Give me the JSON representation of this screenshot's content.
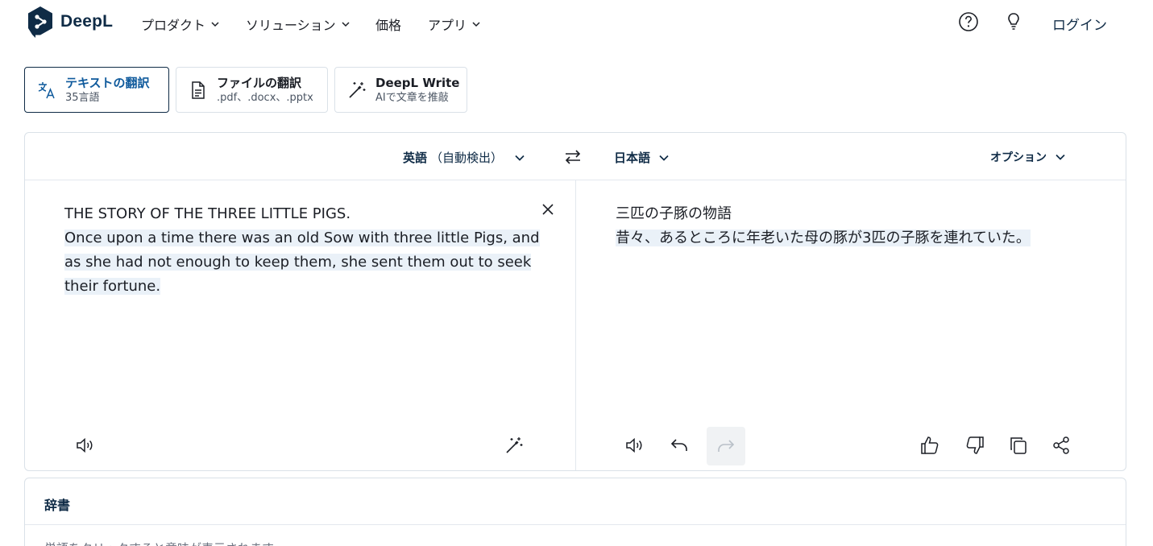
{
  "brand": {
    "name": "DeepL",
    "color": "#0f2b46",
    "accent": "#0f5a9c"
  },
  "nav": [
    {
      "label": "プロダクト",
      "has_dropdown": true
    },
    {
      "label": "ソリューション",
      "has_dropdown": true
    },
    {
      "label": "価格",
      "has_dropdown": false
    },
    {
      "label": "アプリ",
      "has_dropdown": true
    }
  ],
  "header_icons": [
    "help-circle-icon",
    "lightbulb-icon"
  ],
  "login_label": "ログイン",
  "tabs": [
    {
      "title": "テキストの翻訳",
      "subtitle": "35言語",
      "icon": "translate-icon",
      "active": true
    },
    {
      "title": "ファイルの翻訳",
      "subtitle": ".pdf、.docx、.pptx",
      "icon": "document-icon",
      "active": false
    },
    {
      "title": "DeepL Write",
      "subtitle": "AIで文章を推敲",
      "icon": "magic-wand-icon",
      "active": false
    }
  ],
  "translator": {
    "source_lang": "英語",
    "source_detect": "（自動検出）",
    "target_lang": "日本語",
    "options_label": "オプション",
    "source_title": "THE STORY OF THE THREE LITTLE PIGS.",
    "source_body": "Once upon a time there was an old Sow with three little Pigs, and as she had not enough to keep them, she sent them out to seek their fortune.",
    "target_title": "三匹の子豚の物語",
    "target_body": "昔々、あるところに年老いた母の豚が3匹の子豚を連れていた。"
  },
  "dictionary": {
    "title": "辞書",
    "hint": "単語をクリックすると意味が表示されます"
  }
}
